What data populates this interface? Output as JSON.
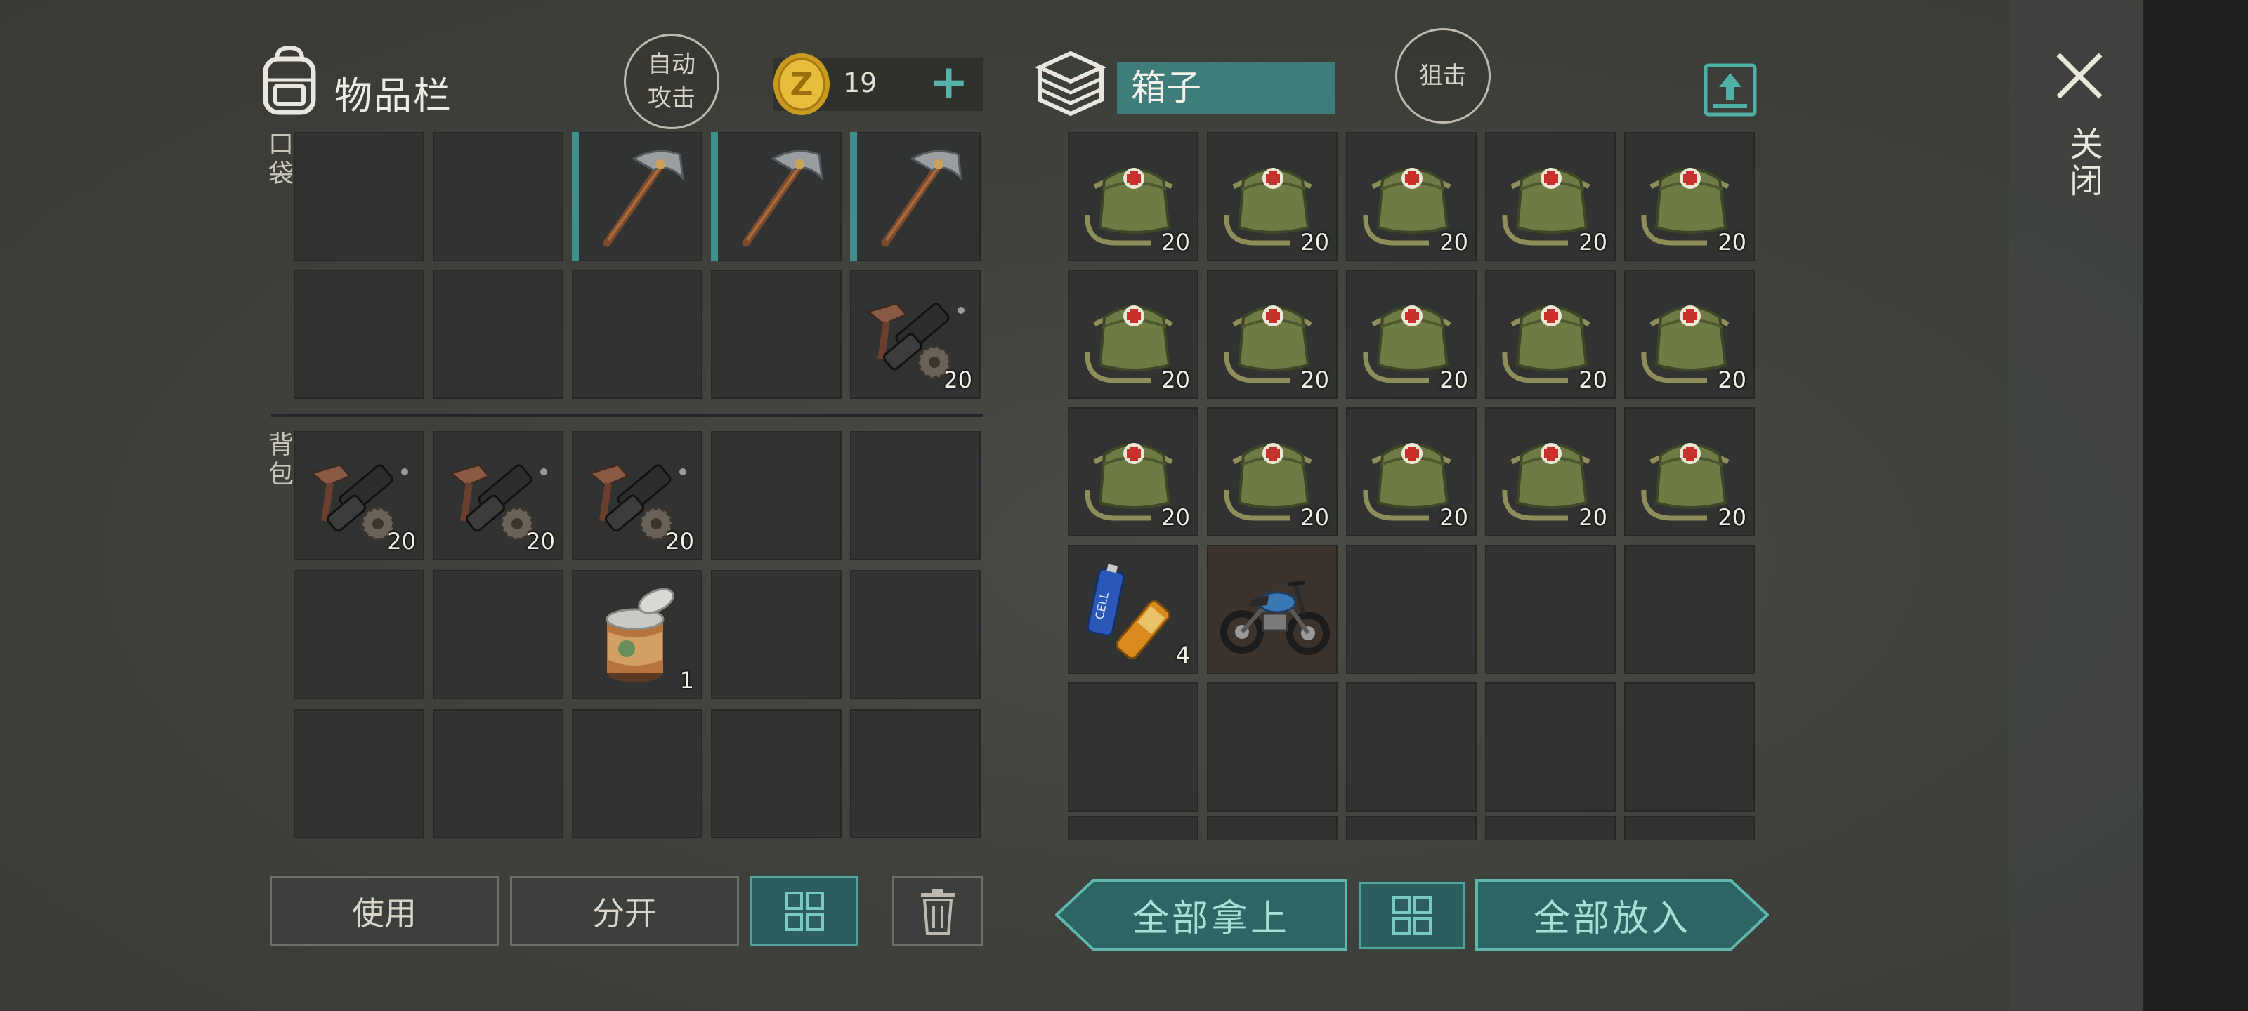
{
  "inventory": {
    "title": "物品栏",
    "auto_attack": [
      "自动",
      "攻击"
    ],
    "coin_count": "19",
    "pocket_label": "口袋",
    "backpack_label": "背包",
    "slot_qty": {
      "p9": "20",
      "b0": "20",
      "b1": "20",
      "b2": "20",
      "b7": "1"
    }
  },
  "box": {
    "name": "箱子",
    "snipe": "狙击",
    "medkit_qty": "20",
    "battery_qty": "4"
  },
  "close_label": "关闭",
  "buttons": {
    "use": "使用",
    "split": "分开",
    "take_all": "全部拿上",
    "put_all": "全部放入"
  },
  "colors": {
    "accent_teal": "#3e7d7a",
    "slot": "#303331"
  }
}
